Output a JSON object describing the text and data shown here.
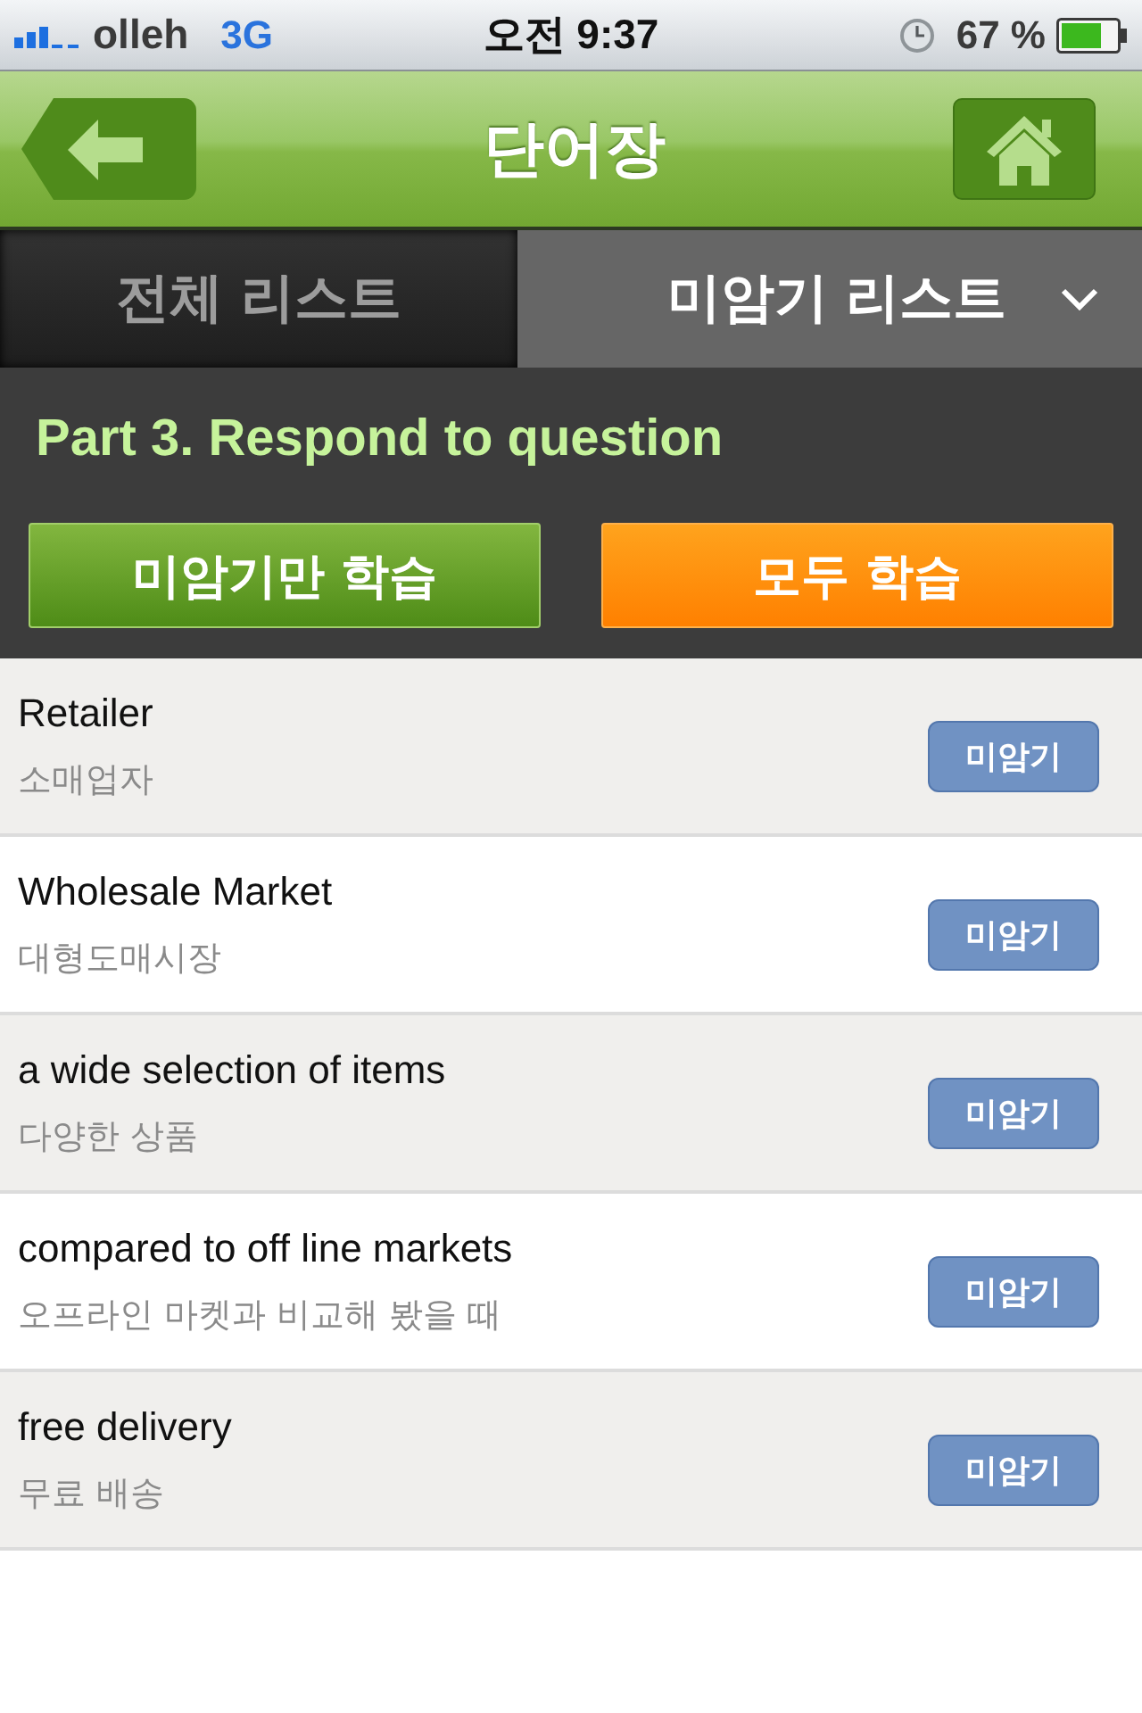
{
  "status_bar": {
    "carrier": "olleh",
    "network": "3G",
    "time": "오전 9:37",
    "battery": "67 %"
  },
  "nav_bar": {
    "title": "단어장"
  },
  "tabs": [
    {
      "label": "전체 리스트",
      "selected": false
    },
    {
      "label": "미암기 리스트",
      "selected": true
    }
  ],
  "section": {
    "title": "Part 3. Respond to question",
    "buttons": [
      {
        "label": "미암기만 학습",
        "kind": "partial"
      },
      {
        "label": "모두 학습",
        "kind": "all"
      }
    ]
  },
  "words": [
    {
      "word": "Retailer",
      "meaning": "소매업자",
      "button": "미암기"
    },
    {
      "word": "Wholesale Market",
      "meaning": "대형도매시장",
      "button": "미암기"
    },
    {
      "word": "a wide selection of items",
      "meaning": "다양한 상품",
      "button": "미암기"
    },
    {
      "word": "compared to off line markets",
      "meaning": "오프라인 마켓과 비교해 봤을 때",
      "button": "미암기"
    },
    {
      "word": "free delivery",
      "meaning": "무료 배송",
      "button": "미암기"
    }
  ]
}
